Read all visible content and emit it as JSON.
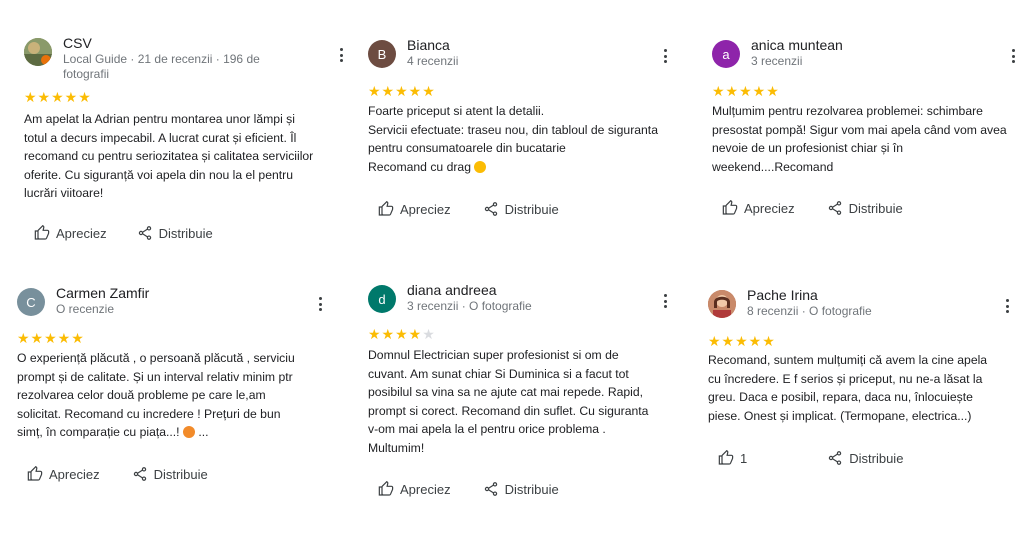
{
  "reviews": [
    {
      "initial": "",
      "avatar_color": "#7a8a5a",
      "name": "CSV",
      "meta": "Local Guide · 21 de recenzii · 196 de fotografii",
      "stars": "★★★★★",
      "rating": 5,
      "text_lines": [
        "Am apelat la Adrian pentru montarea unor lămpi și",
        "totul a decurs impecabil. A lucrat curat și eficient. Îl",
        "recomand cu pentru seriozitatea și calitatea serviciilor",
        "oferite. Cu siguranță voi apela din nou la el pentru",
        "lucrări viitoare!"
      ],
      "like_label": "Apreciez",
      "share_label": "Distribuie"
    },
    {
      "initial": "B",
      "avatar_color": "#6d4c41",
      "name": "Bianca",
      "meta": "4 recenzii",
      "stars": "★★★★★",
      "rating": 5,
      "text_lines": [
        "Foarte priceput si atent la detalii.",
        "Servicii efectuate: traseu nou, din tabloul de siguranta",
        "pentru consumatoarele din bucatarie",
        "Recomand cu drag"
      ],
      "like_label": "Apreciez",
      "share_label": "Distribuie"
    },
    {
      "initial": "a",
      "avatar_color": "#8e24aa",
      "name": "anica muntean",
      "meta": "3 recenzii",
      "stars": "★★★★★",
      "rating": 5,
      "text_lines": [
        "Mulțumim pentru rezolvarea problemei: schimbare",
        "presostat pompă! Sigur vom mai apela când vom avea",
        "nevoie de un profesionist chiar și în",
        "weekend....Recomand"
      ],
      "like_label": "Apreciez",
      "share_label": "Distribuie"
    },
    {
      "initial": "C",
      "avatar_color": "#78909c",
      "name": "Carmen Zamfir",
      "meta": "O recenzie",
      "stars": "★★★★★",
      "rating": 5,
      "text_lines": [
        "O experiență plăcută , o persoană plăcută , serviciu",
        "prompt și de calitate. Și un interval relativ minim ptr",
        "rezolvarea celor două probleme pe care le,am",
        "solicitat. Recomand cu incredere ! Prețuri de bun",
        "simț, în comparație cu piața...!"
      ],
      "text_suffix": "...",
      "like_label": "Apreciez",
      "share_label": "Distribuie"
    },
    {
      "initial": "d",
      "avatar_color": "#00796b",
      "name": "diana andreea",
      "meta": "3 recenzii · O fotografie",
      "stars": "★★★★",
      "rating": 4.5,
      "text_lines": [
        "Domnul Electrician super profesionist si om de",
        "cuvant. Am sunat chiar Si Duminica si a facut tot",
        "posibilul sa vina sa ne ajute cat mai repede. Rapid,",
        "prompt si corect. Recomand din suflet. Cu siguranta",
        "v-om mai apela la el pentru orice problema .",
        "Multumim!"
      ],
      "like_label": "Apreciez",
      "share_label": "Distribuie"
    },
    {
      "initial": "",
      "avatar_color": "#b5654a",
      "name": "Pache Irina",
      "meta": "8 recenzii · O fotografie",
      "stars": "★★★★★",
      "rating": 5,
      "text_lines": [
        "Recomand, suntem mulțumiți că avem la cine apela",
        "cu încredere. E f serios și priceput, nu ne-a lăsat la",
        "greu. Daca e posibil, repara, daca nu, înlocuiește",
        "piese. Onest și implicat. (Termopane, electrica...)"
      ],
      "like_label": "1",
      "share_label": "Distribuie"
    }
  ]
}
